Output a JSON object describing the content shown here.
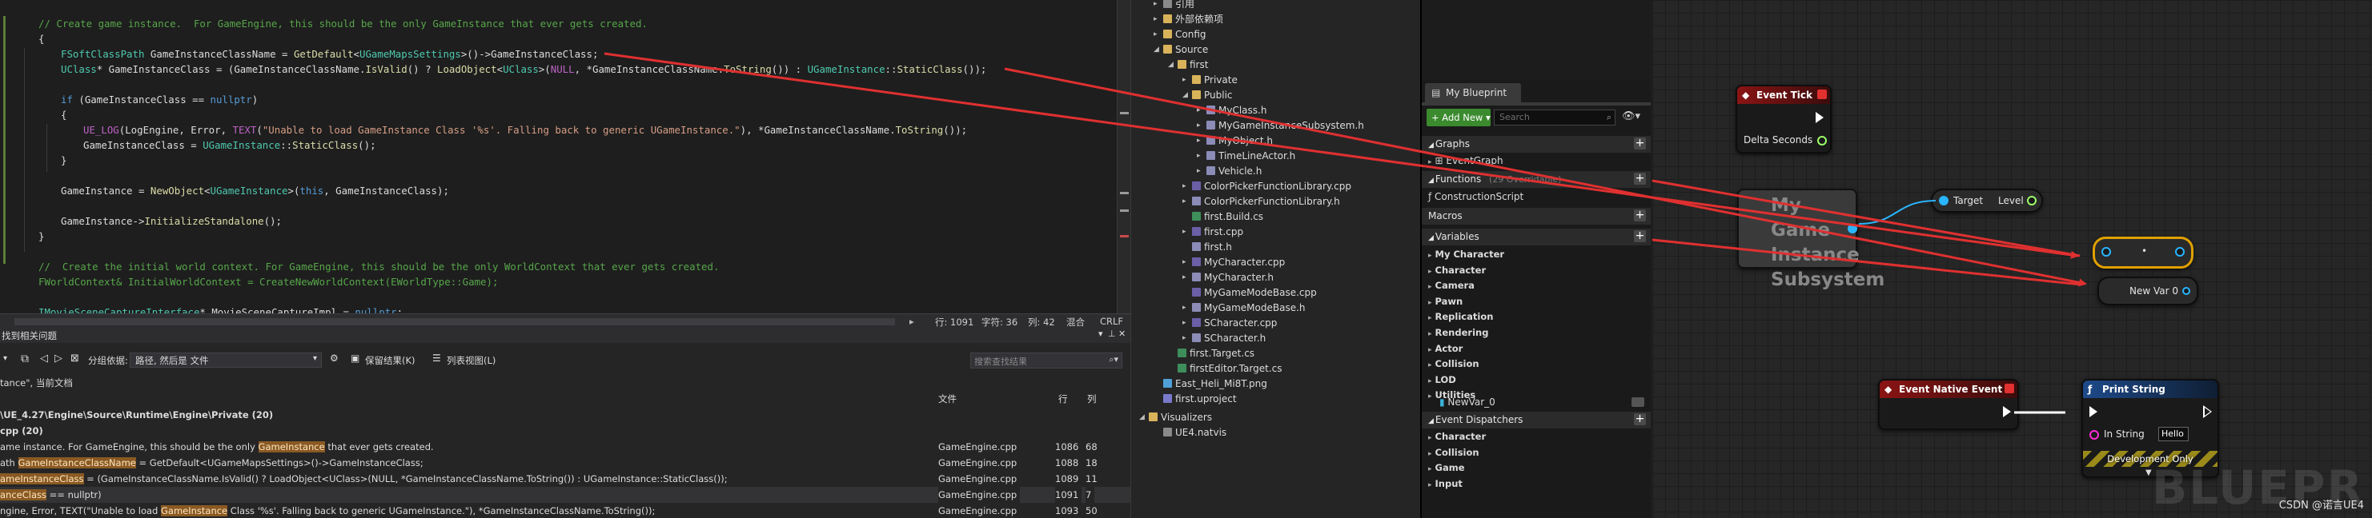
{
  "editor": {
    "lines": [
      {
        "indent": 1,
        "tokens": [
          [
            "c",
            "// Create game instance.  For GameEngine, this should be the only GameInstance that ever gets created."
          ]
        ]
      },
      {
        "indent": 1,
        "tokens": [
          [
            "p",
            "{"
          ]
        ]
      },
      {
        "indent": 2,
        "tokens": [
          [
            "t",
            "FSoftClassPath"
          ],
          [
            "p",
            " GameInstanceClassName = "
          ],
          [
            "f",
            "GetDefault"
          ],
          [
            "p",
            "<"
          ],
          [
            "t",
            "UGameMapsSettings"
          ],
          [
            "p",
            ">()->GameInstanceClass;"
          ]
        ]
      },
      {
        "indent": 2,
        "tokens": [
          [
            "t",
            "UClass"
          ],
          [
            "p",
            "* GameInstanceClass = (GameInstanceClassName."
          ],
          [
            "f",
            "IsValid"
          ],
          [
            "p",
            "() ? "
          ],
          [
            "f",
            "LoadObject"
          ],
          [
            "p",
            "<"
          ],
          [
            "t",
            "UClass"
          ],
          [
            "p",
            ">("
          ],
          [
            "m",
            "NULL"
          ],
          [
            "p",
            ", *GameInstanceClassName."
          ],
          [
            "f",
            "ToString"
          ],
          [
            "p",
            "()) : "
          ],
          [
            "t",
            "UGameInstance"
          ],
          [
            "p",
            "::"
          ],
          [
            "f",
            "StaticClass"
          ],
          [
            "p",
            "());"
          ]
        ]
      },
      {
        "indent": 0,
        "tokens": [
          [
            "p",
            ""
          ]
        ]
      },
      {
        "indent": 2,
        "tokens": [
          [
            "k",
            "if"
          ],
          [
            "p",
            " (GameInstanceClass == "
          ],
          [
            "k",
            "nullptr"
          ],
          [
            "p",
            ")"
          ]
        ]
      },
      {
        "indent": 2,
        "tokens": [
          [
            "p",
            "{"
          ]
        ]
      },
      {
        "indent": 3,
        "tokens": [
          [
            "m",
            "UE_LOG"
          ],
          [
            "p",
            "(LogEngine, Error, "
          ],
          [
            "m",
            "TEXT"
          ],
          [
            "p",
            "("
          ],
          [
            "s",
            "\"Unable to load GameInstance Class '%s'. Falling back to generic UGameInstance.\""
          ],
          [
            "p",
            "), *GameInstanceClassName."
          ],
          [
            "f",
            "ToString"
          ],
          [
            "p",
            "());"
          ]
        ]
      },
      {
        "indent": 3,
        "tokens": [
          [
            "p",
            "GameInstanceClass = "
          ],
          [
            "t",
            "UGameInstance"
          ],
          [
            "p",
            "::"
          ],
          [
            "f",
            "StaticClass"
          ],
          [
            "p",
            "();"
          ]
        ]
      },
      {
        "indent": 2,
        "tokens": [
          [
            "p",
            "}"
          ]
        ]
      },
      {
        "indent": 0,
        "tokens": [
          [
            "p",
            ""
          ]
        ]
      },
      {
        "indent": 2,
        "tokens": [
          [
            "p",
            "GameInstance = "
          ],
          [
            "f",
            "NewObject"
          ],
          [
            "p",
            "<"
          ],
          [
            "t",
            "UGameInstance"
          ],
          [
            "p",
            ">("
          ],
          [
            "k",
            "this"
          ],
          [
            "p",
            ", GameInstanceClass);"
          ]
        ]
      },
      {
        "indent": 0,
        "tokens": [
          [
            "p",
            ""
          ]
        ]
      },
      {
        "indent": 2,
        "tokens": [
          [
            "p",
            "GameInstance->"
          ],
          [
            "f",
            "InitializeStandalone"
          ],
          [
            "p",
            "();"
          ]
        ]
      },
      {
        "indent": 1,
        "tokens": [
          [
            "p",
            "}"
          ]
        ]
      },
      {
        "indent": 0,
        "tokens": [
          [
            "p",
            ""
          ]
        ]
      },
      {
        "indent": 1,
        "tokens": [
          [
            "c",
            "//  Create the initial world context. For GameEngine, this should be the only WorldContext that ever gets created."
          ]
        ]
      },
      {
        "indent": 1,
        "tokens": [
          [
            "c",
            "FWorldContext& InitialWorldContext = CreateNewWorldContext(EWorldType::Game);"
          ]
        ]
      },
      {
        "indent": 0,
        "tokens": [
          [
            "p",
            ""
          ]
        ]
      },
      {
        "indent": 1,
        "tokens": [
          [
            "t",
            "IMovieSceneCaptureInterface"
          ],
          [
            "p",
            "* MovieSceneCaptureImpl = "
          ],
          [
            "k",
            "nullptr"
          ],
          [
            "p",
            ";"
          ]
        ]
      }
    ],
    "status": {
      "line": "行: 1091",
      "char": "字符: 36",
      "col": "列: 42",
      "mode": "混合",
      "eol": "CRLF"
    }
  },
  "find": {
    "title": "找到相关问题",
    "toolbar": {
      "group_label": "分组依据:",
      "group_value": "路径, 然后是 文件",
      "keep_results": "保留结果(K)",
      "list_view": "列表视图(L)",
      "search_placeholder": "搜索查找结果"
    },
    "scope": "tance\", 当前文档",
    "columns": {
      "file": "文件",
      "line": "行",
      "col": "列"
    },
    "path_group": "\\UE_4.27\\Engine\\Source\\Runtime\\Engine\\Private (20)",
    "file_group": "cpp (20)",
    "results": [
      {
        "pre": "ame instance.  For GameEngine, this should be the only ",
        "hit": "GameInstance",
        "post": " that ever gets created.",
        "file": "GameEngine.cpp",
        "line": "1086",
        "col": "68"
      },
      {
        "pre": "ath ",
        "hit": "GameInstanceClassName",
        "post": " = GetDefault<UGameMapsSettings>()->GameInstanceClass;",
        "file": "GameEngine.cpp",
        "line": "1088",
        "col": "18"
      },
      {
        "pre": "",
        "hit": "ameInstanceClass",
        "post": " = (GameInstanceClassName.IsValid() ? LoadObject<UClass>(NULL, *GameInstanceClassName.ToString()) : UGameInstance::StaticClass());",
        "file": "GameEngine.cpp",
        "line": "1089",
        "col": "11"
      },
      {
        "pre": "",
        "hit": "anceClass",
        "post": " == nullptr)",
        "file": "GameEngine.cpp",
        "line": "1091",
        "col": "7"
      },
      {
        "pre": "ngine, Error, TEXT(\"Unable to load ",
        "hit": "GameInstance",
        "post": " Class '%s'. Falling back to generic UGameInstance.\"), *GameInstanceClassName.ToString());",
        "file": "GameEngine.cpp",
        "line": "1093",
        "col": "50"
      }
    ]
  },
  "explorer": {
    "items": [
      {
        "depth": 1,
        "caret": "▸",
        "icon": "ref",
        "label": "引用"
      },
      {
        "depth": 1,
        "caret": "▸",
        "icon": "folder",
        "label": "外部依赖项"
      },
      {
        "depth": 1,
        "caret": "▸",
        "icon": "folder",
        "label": "Config"
      },
      {
        "depth": 1,
        "caret": "◢",
        "icon": "folder",
        "label": "Source"
      },
      {
        "depth": 2,
        "caret": "◢",
        "icon": "folder",
        "label": "first"
      },
      {
        "depth": 3,
        "caret": "▸",
        "icon": "folder",
        "label": "Private"
      },
      {
        "depth": 3,
        "caret": "◢",
        "icon": "folder",
        "label": "Public"
      },
      {
        "depth": 4,
        "caret": "▸",
        "icon": "h",
        "label": "MyClass.h"
      },
      {
        "depth": 4,
        "caret": "▸",
        "icon": "h",
        "label": "MyGameInstanceSubsystem.h"
      },
      {
        "depth": 4,
        "caret": "▸",
        "icon": "h",
        "label": "MyObject.h"
      },
      {
        "depth": 4,
        "caret": "▸",
        "icon": "h",
        "label": "TimeLineActor.h"
      },
      {
        "depth": 4,
        "caret": "▸",
        "icon": "h",
        "label": "Vehicle.h"
      },
      {
        "depth": 3,
        "caret": "▸",
        "icon": "cpp",
        "label": "ColorPickerFunctionLibrary.cpp"
      },
      {
        "depth": 3,
        "caret": "▸",
        "icon": "h",
        "label": "ColorPickerFunctionLibrary.h"
      },
      {
        "depth": 3,
        "caret": "",
        "icon": "cs",
        "label": "first.Build.cs"
      },
      {
        "depth": 3,
        "caret": "▸",
        "icon": "cpp",
        "label": "first.cpp"
      },
      {
        "depth": 3,
        "caret": "",
        "icon": "h",
        "label": "first.h"
      },
      {
        "depth": 3,
        "caret": "▸",
        "icon": "cpp",
        "label": "MyCharacter.cpp"
      },
      {
        "depth": 3,
        "caret": "▸",
        "icon": "h",
        "label": "MyCharacter.h"
      },
      {
        "depth": 3,
        "caret": "",
        "icon": "cpp",
        "label": "MyGameModeBase.cpp"
      },
      {
        "depth": 3,
        "caret": "▸",
        "icon": "h",
        "label": "MyGameModeBase.h"
      },
      {
        "depth": 3,
        "caret": "▸",
        "icon": "cpp",
        "label": "SCharacter.cpp"
      },
      {
        "depth": 3,
        "caret": "▸",
        "icon": "h",
        "label": "SCharacter.h"
      },
      {
        "depth": 2,
        "caret": "",
        "icon": "cs",
        "label": "first.Target.cs"
      },
      {
        "depth": 2,
        "caret": "",
        "icon": "cs",
        "label": "firstEditor.Target.cs"
      },
      {
        "depth": 1,
        "caret": "",
        "icon": "img",
        "label": "East_Heli_Mi8T.png"
      },
      {
        "depth": 1,
        "caret": "",
        "icon": "proj",
        "label": "first.uproject"
      },
      {
        "depth": 0,
        "caret": "◢",
        "icon": "folder",
        "label": "Visualizers"
      },
      {
        "depth": 1,
        "caret": "",
        "icon": "ref",
        "label": "UE4.natvis"
      }
    ]
  },
  "blueprint": {
    "tab_label": "My Blueprint",
    "add_new": "+ Add New ▾",
    "search_placeholder": "Search",
    "graphs_label": "Graphs",
    "event_graph": "EventGraph",
    "functions_label": "Functions",
    "functions_note": "(29 Overridable)",
    "construction_script": "ConstructionScript",
    "macros_label": "Macros",
    "variables_label": "Variables",
    "variable_categories": [
      "My Character",
      "Character",
      "Camera",
      "Pawn",
      "Replication",
      "Rendering",
      "Actor",
      "Collision",
      "LOD",
      "Utilities"
    ],
    "variable_item": "NewVar_0",
    "dispatchers_label": "Event Dispatchers",
    "dispatcher_categories": [
      "Character",
      "Collision",
      "Game",
      "Input"
    ]
  },
  "graph": {
    "event_tick": {
      "title": "Event Tick",
      "delta_label": "Delta Seconds"
    },
    "subsystem": {
      "title": "My Game Instance Subsystem"
    },
    "target_node": {
      "target": "Target",
      "level": "Level"
    },
    "get_node_dot": "•",
    "newvar_node": "New Var 0",
    "native_event": {
      "title": "Event Native Event"
    },
    "print_string": {
      "title": "Print String",
      "in_string_label": "In String",
      "in_string_value": "Hello",
      "dev_only": "Development Only"
    },
    "watermark": "BLUEPR",
    "credit": "CSDN @诺言UE4"
  },
  "colors": {
    "comment": "#57a64a",
    "keyword": "#569cd6",
    "type": "#4ec9b0",
    "function": "#dcdcaa",
    "string": "#d69d85",
    "macro": "#bd63c5",
    "event_red": "#7a1212",
    "function_blue": "#1e4a7a",
    "arrow_red": "#e03030",
    "highlight": "#8a5a22"
  }
}
